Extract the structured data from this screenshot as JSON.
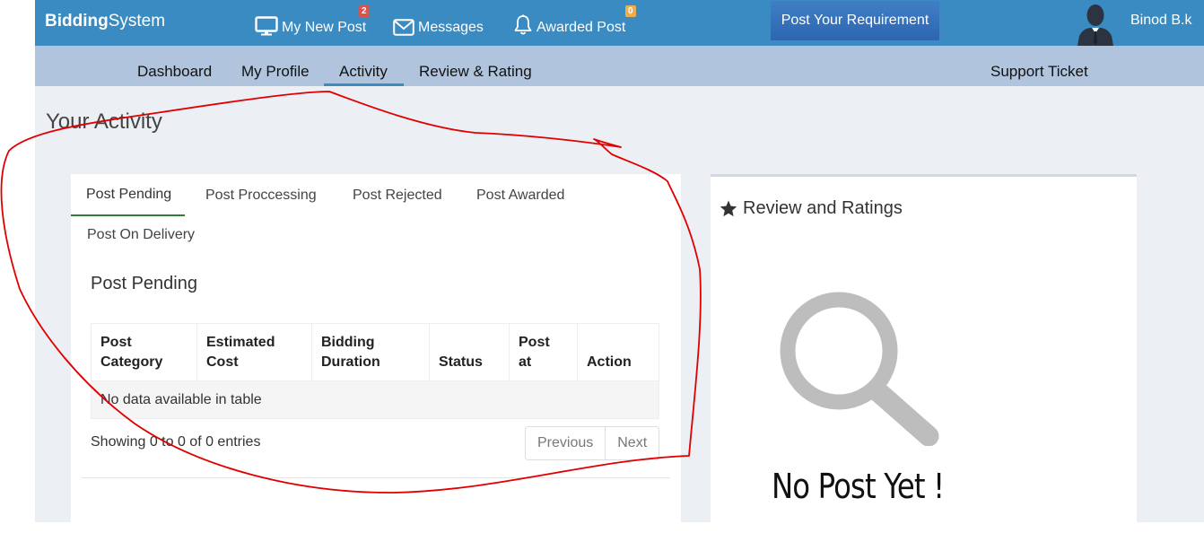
{
  "brand": {
    "bold": "Bidding",
    "rest": "System"
  },
  "top_nav": {
    "my_new_post": {
      "label": "My New Post",
      "badge": "2"
    },
    "messages": {
      "label": "Messages"
    },
    "awarded_post": {
      "label": "Awarded Post",
      "badge": "0"
    },
    "post_requirement": "Post Your Requirement",
    "user_name": "Binod B.k"
  },
  "sub_nav": {
    "items": [
      "Dashboard",
      "My Profile",
      "Activity",
      "Review & Rating"
    ],
    "active": "Activity",
    "support": "Support Ticket"
  },
  "page_title": "Your Activity",
  "activity": {
    "tabs": [
      "Post Pending",
      "Post Proccessing",
      "Post Rejected",
      "Post Awarded",
      "Post On Delivery"
    ],
    "active_tab": "Post Pending",
    "section_title": "Post Pending",
    "table": {
      "headers": [
        [
          "Post",
          "Category"
        ],
        [
          "Estimated",
          "Cost"
        ],
        [
          "Bidding",
          "Duration"
        ],
        [
          "",
          "Status"
        ],
        [
          "Post",
          "at"
        ],
        [
          "",
          "Action"
        ]
      ],
      "empty_message": "No data available in table"
    },
    "info": "Showing 0 to 0 of 0 entries",
    "pagination": {
      "previous": "Previous",
      "next": "Next"
    }
  },
  "reviews": {
    "title": "Review and Ratings",
    "empty_text": "No Post Yet !"
  },
  "colors": {
    "topbar": "#3a8bc2",
    "subbar": "#b0c4de",
    "active_tab_underline": "#2e7d32",
    "annotation_stroke": "#e00000"
  },
  "icons": [
    "monitor-icon",
    "envelope-icon",
    "bell-icon",
    "star-icon",
    "magnifier-icon",
    "user-avatar-icon"
  ]
}
